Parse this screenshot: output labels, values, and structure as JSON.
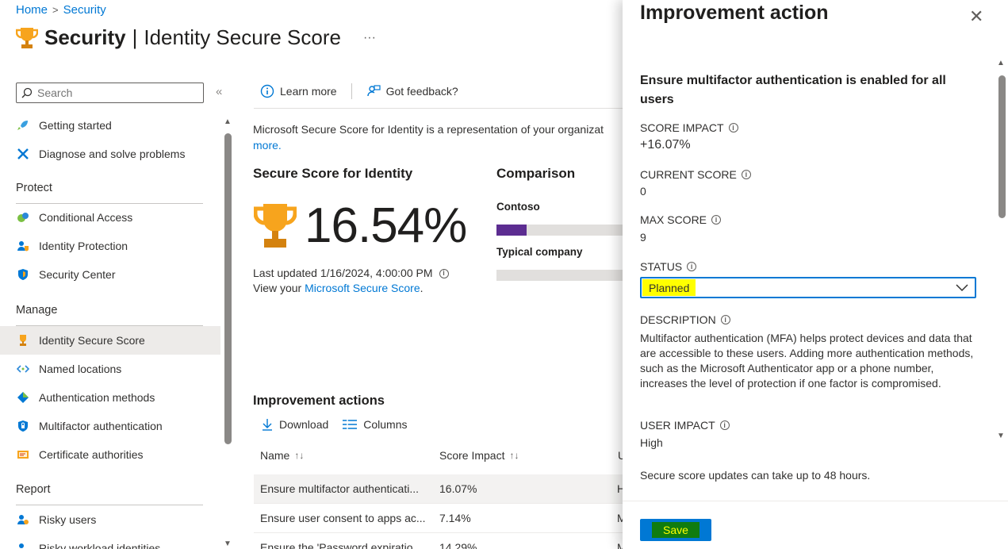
{
  "breadcrumb": {
    "home": "Home",
    "sep": ">",
    "current": "Security"
  },
  "header": {
    "title_strong": "Security",
    "title_sep": "|",
    "title_light": "Identity Secure Score",
    "more": "···"
  },
  "sidebar": {
    "search_placeholder": "Search",
    "collapse": "«",
    "items_top": [
      {
        "label": "Getting started",
        "icon": "rocket-icon"
      },
      {
        "label": "Diagnose and solve problems",
        "icon": "wrench-icon"
      }
    ],
    "sections": [
      {
        "heading": "Protect",
        "items": [
          {
            "label": "Conditional Access",
            "icon": "conditional-access-icon"
          },
          {
            "label": "Identity Protection",
            "icon": "identity-protection-icon"
          },
          {
            "label": "Security Center",
            "icon": "shield-icon"
          }
        ]
      },
      {
        "heading": "Manage",
        "items": [
          {
            "label": "Identity Secure Score",
            "icon": "trophy-icon",
            "active": true
          },
          {
            "label": "Named locations",
            "icon": "named-locations-icon"
          },
          {
            "label": "Authentication methods",
            "icon": "authentication-methods-icon"
          },
          {
            "label": "Multifactor authentication",
            "icon": "mfa-icon"
          },
          {
            "label": "Certificate authorities",
            "icon": "certificate-icon"
          }
        ]
      },
      {
        "heading": "Report",
        "items": [
          {
            "label": "Risky users",
            "icon": "risky-users-icon"
          },
          {
            "label": "Risky workload identities",
            "icon": "risky-workload-icon"
          }
        ]
      }
    ]
  },
  "toolbar": {
    "learn_more": "Learn more",
    "feedback": "Got feedback?"
  },
  "main": {
    "description_line1": "Microsoft Secure Score for Identity is a representation of your organizat",
    "description_line2": "more.",
    "score_heading": "Secure Score for Identity",
    "score_value": "16.54%",
    "last_updated": "Last updated 1/16/2024, 4:00:00 PM",
    "view_prefix": "View your",
    "view_link": "Microsoft Secure Score",
    "view_suffix": ".",
    "comparison_heading": "Comparison",
    "comparison": [
      {
        "label": "Contoso",
        "fill_percent": 24,
        "color": "#5c2d91"
      },
      {
        "label": "Typical company",
        "fill_percent": 0,
        "color": "#5c2d91"
      }
    ],
    "improvement_heading": "Improvement actions",
    "download": "Download",
    "columns": "Columns",
    "col_name": "Name",
    "col_impact": "Score Impact",
    "col_third": "U",
    "rows": [
      {
        "name": "Ensure multifactor authenticati...",
        "impact": "16.07%",
        "third": "H"
      },
      {
        "name": "Ensure user consent to apps ac...",
        "impact": "7.14%",
        "third": "M"
      },
      {
        "name": "Ensure the 'Password expiratio...",
        "impact": "14.29%",
        "third": "M"
      }
    ]
  },
  "panel": {
    "title": "Improvement action",
    "close": "✕",
    "heading": "Ensure multifactor authentication is enabled for all users",
    "score_impact_label": "SCORE IMPACT",
    "score_impact_value": "+16.07%",
    "current_score_label": "CURRENT SCORE",
    "current_score_value": "0",
    "max_score_label": "MAX SCORE",
    "max_score_value": "9",
    "status_label": "STATUS",
    "status_value": "Planned",
    "description_label": "DESCRIPTION",
    "description_text": "Multifactor authentication (MFA) helps protect devices and data that are accessible to these users. Adding more authentication methods, such as the Microsoft Authenticator app or a phone number, increases the level of protection if one factor is compromised.",
    "user_impact_label": "USER IMPACT",
    "user_impact_value": "High",
    "note": "Secure score updates can take up to 48 hours.",
    "save": "Save"
  },
  "colors": {
    "accent": "#0078d4",
    "highlight": "#ffff00",
    "save_bg": "#107c10"
  }
}
